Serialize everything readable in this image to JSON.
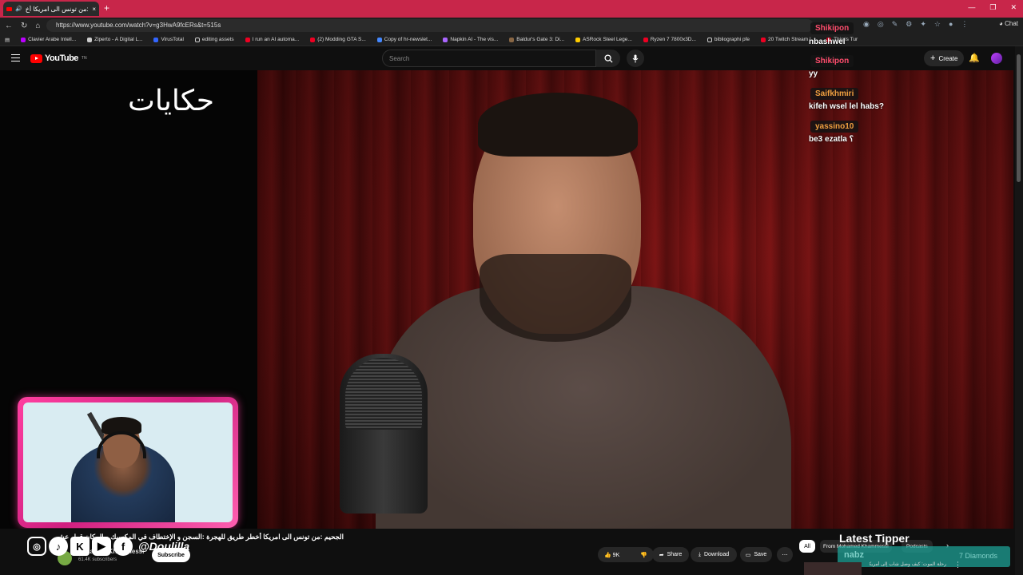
{
  "browser": {
    "tab_title": "الجحيم :من تونس الى امريكا أخ",
    "new_tab": "+",
    "url": "https://www.youtube.com/watch?v=g3HwA9fcERs&t=515s",
    "chat_label": "Chat",
    "bookmarks": [
      "Clavier Arabe Intell...",
      "Ziperto - A Digital L...",
      "VirusTotal",
      "editing assets",
      "I run an AI automa...",
      "(2) Modding GTA S...",
      "Copy of hr-newslet...",
      "Napkin AI - The vis...",
      "Baldur's Gate 3: Di...",
      "ASRock Steel Lege...",
      "Ryzen 7 7800x3D...",
      "bibliographi pfe",
      "20 Twitch Stream I...",
      "This is Tur"
    ]
  },
  "youtube": {
    "logo_text": "YouTube",
    "logo_sup": "TN",
    "search_placeholder": "Search",
    "create_label": "Create",
    "video_overlay_text": "حكايات",
    "video_title": "الجحيم :من تونس الى امريكا أخطر طريق للهجرة :السجن و الإختطاف في المكسيك و المكان قرار عشر!!",
    "social_handle": "@Doulilla",
    "channel_name": "Mohamed Khammessi",
    "subscribers": "61.4K subscribers",
    "subscribe_label": "Subscribe",
    "likes": "9K",
    "share_label": "Share",
    "download_label": "Download",
    "save_label": "Save",
    "chips": {
      "all": "All",
      "from": "From Mohamed Khammessi",
      "podcasts": "Podcasts"
    },
    "rec_title": "رحلة الموت: كيف وصل شاب إلى أمريكا"
  },
  "stream_overlay": {
    "latest_tipper_title": "Latest Tipper",
    "tipper_name": "nabz",
    "tipper_amount": "7 Diamonds"
  },
  "chat": [
    {
      "user": "Shikipon",
      "text": "nbashwel",
      "color": "#ff4d6d"
    },
    {
      "user": "Shikipon",
      "text": "yy",
      "color": "#ff4d6d"
    },
    {
      "user": "Saifkhmiri",
      "text": "kifeh wsel lel habs?",
      "color": "#f0a040"
    },
    {
      "user": "yassino10",
      "text": "be3 ezatla ؟",
      "color": "#f0a040"
    }
  ]
}
